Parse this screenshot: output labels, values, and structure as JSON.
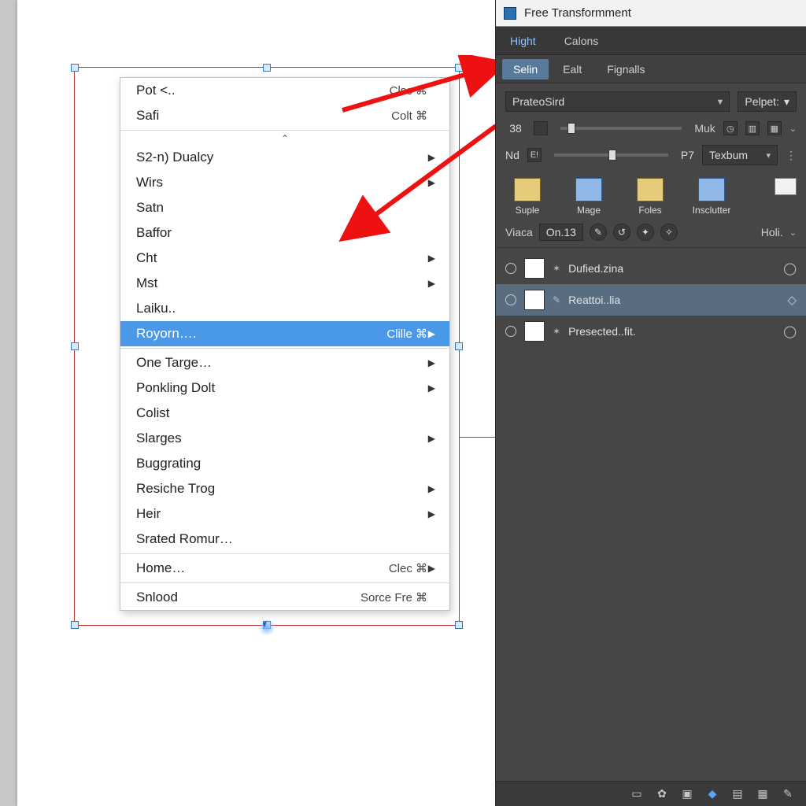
{
  "context_menu": {
    "groups": [
      [
        {
          "label": "Pot <..",
          "shortcut": "Clsc ⌘",
          "submenu": false
        },
        {
          "label": "Safi",
          "shortcut": "Colt ⌘",
          "submenu": false
        }
      ],
      [
        {
          "label": "S2-n) Dualcy",
          "shortcut": "",
          "submenu": true
        },
        {
          "label": "Wirs",
          "shortcut": "",
          "submenu": true
        },
        {
          "label": "Satn",
          "shortcut": "",
          "submenu": false
        },
        {
          "label": "Baffor",
          "shortcut": "",
          "submenu": false
        },
        {
          "label": "Cht",
          "shortcut": "",
          "submenu": true
        },
        {
          "label": "Mst",
          "shortcut": "",
          "submenu": true
        },
        {
          "label": "Laiku..",
          "shortcut": "",
          "submenu": false
        },
        {
          "label": "Royorn….",
          "shortcut": "Clille ⌘",
          "submenu": true,
          "selected": true
        }
      ],
      [
        {
          "label": "One Targe…",
          "shortcut": "",
          "submenu": true
        },
        {
          "label": "Ponkling Dolt",
          "shortcut": "",
          "submenu": true
        },
        {
          "label": "Colist",
          "shortcut": "",
          "submenu": false
        },
        {
          "label": "Slarges",
          "shortcut": "",
          "submenu": true
        },
        {
          "label": "Buggrating",
          "shortcut": "",
          "submenu": false
        },
        {
          "label": "Resiche Trog",
          "shortcut": "",
          "submenu": true
        },
        {
          "label": "Heir",
          "shortcut": "",
          "submenu": true
        },
        {
          "label": "Srated Romur…",
          "shortcut": "",
          "submenu": false
        }
      ],
      [
        {
          "label": "Home…",
          "shortcut": "Clec ⌘",
          "submenu": true
        }
      ],
      [
        {
          "label": "Snlood",
          "shortcut": "Sorce Fre ⌘",
          "submenu": false
        }
      ]
    ]
  },
  "panel": {
    "title": "Free Transformment",
    "tabs": [
      {
        "label": "Hight",
        "active": true
      },
      {
        "label": "Calons",
        "active": false
      }
    ],
    "subtabs": [
      {
        "label": "Selin",
        "active": true
      },
      {
        "label": "Ealt",
        "active": false
      },
      {
        "label": "Fignalls",
        "active": false
      }
    ],
    "preset": {
      "value": "PrateoSird",
      "field_label": "Pelpet:",
      "field_value": ""
    },
    "row_a": {
      "num": "38",
      "label_right": "Muk"
    },
    "row_b": {
      "label_left": "Nd",
      "icon": "E!",
      "label_mid": "P7",
      "combo": "Texbum"
    },
    "big_icons": [
      {
        "name": "suple",
        "label": "Suple"
      },
      {
        "name": "mage",
        "label": "Mage"
      },
      {
        "name": "foles",
        "label": "Foles"
      },
      {
        "name": "insclutter",
        "label": "Insclutter"
      }
    ],
    "folder_plain": true,
    "toolbar": {
      "left_label": "Viaca",
      "value_label": "On.13",
      "right_label": "Holi."
    },
    "layers": [
      {
        "name": "Dufied.zina",
        "selected": false
      },
      {
        "name": "Reattoi..lia",
        "selected": true
      },
      {
        "name": "Presected..fit.",
        "selected": false
      }
    ]
  }
}
